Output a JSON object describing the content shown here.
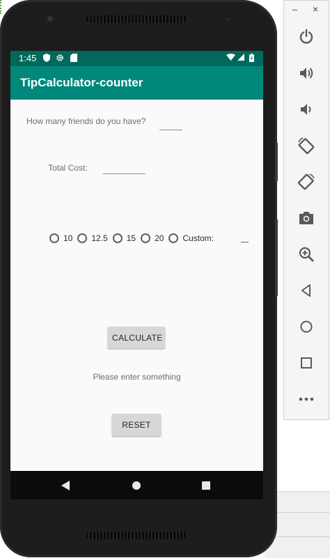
{
  "status_bar": {
    "time": "1:45",
    "icons": [
      "shield-icon",
      "gear-icon",
      "sd-card-icon",
      "wifi-icon",
      "signal-icon",
      "battery-icon"
    ]
  },
  "app": {
    "title": "TipCalculator-counter"
  },
  "form": {
    "friends_label": "How many friends do you have?",
    "friends_value": "",
    "cost_label": "Total Cost:",
    "cost_value": "",
    "tip_options": [
      "10",
      "12.5",
      "15",
      "20"
    ],
    "custom_label": "Custom:",
    "custom_value": ""
  },
  "buttons": {
    "calculate": "CALCULATE",
    "reset": "RESET"
  },
  "message": "Please enter something",
  "toolbar": {
    "window_minimize": "–",
    "window_close": "×",
    "tools": [
      "power-icon",
      "volume-up-icon",
      "volume-down-icon",
      "rotate-left-icon",
      "rotate-right-icon",
      "camera-icon",
      "zoom-icon",
      "back-icon",
      "home-icon",
      "overview-icon",
      "more-icon"
    ]
  },
  "colors": {
    "status_bar": "#00695c",
    "app_bar": "#00897b",
    "background": "#fafafa",
    "button": "#d6d7d7",
    "toolbar_icon": "#5a5a5a"
  }
}
